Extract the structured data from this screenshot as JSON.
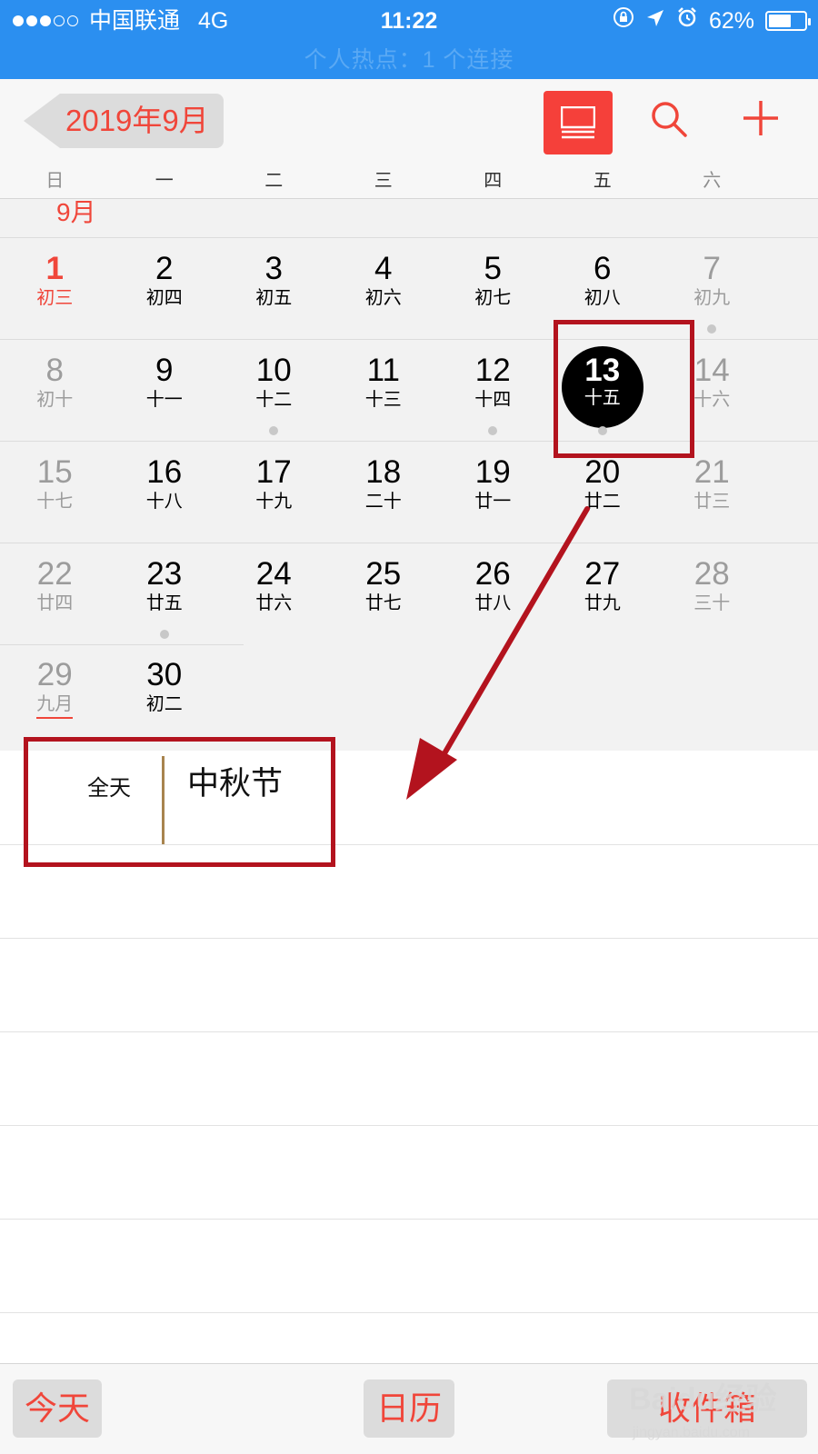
{
  "status_bar": {
    "carrier": "●●●○○ 中国联通",
    "carrier_name": "中国联通",
    "network": "4G",
    "time": "11:22",
    "battery_percent": "62%",
    "battery_level": 0.62,
    "hotspot": "个人热点：1 个连接"
  },
  "nav": {
    "back_label": "2019年9月",
    "list_icon": "list-view-icon",
    "search_icon": "search-icon",
    "add_icon": "plus-icon"
  },
  "weekdays": [
    "日",
    "一",
    "二",
    "三",
    "四",
    "五",
    "六"
  ],
  "month_label": "9月",
  "weeks": [
    [
      {
        "day": "1",
        "lunar": "初三",
        "today": true
      },
      {
        "day": "2",
        "lunar": "初四"
      },
      {
        "day": "3",
        "lunar": "初五"
      },
      {
        "day": "4",
        "lunar": "初六"
      },
      {
        "day": "5",
        "lunar": "初七"
      },
      {
        "day": "6",
        "lunar": "初八"
      },
      {
        "day": "7",
        "lunar": "初九",
        "dot": true
      }
    ],
    [
      {
        "day": "8",
        "lunar": "初十"
      },
      {
        "day": "9",
        "lunar": "十一"
      },
      {
        "day": "10",
        "lunar": "十二",
        "dot": true
      },
      {
        "day": "11",
        "lunar": "十三"
      },
      {
        "day": "12",
        "lunar": "十四",
        "dot": true
      },
      {
        "day": "13",
        "lunar": "十五",
        "selected": true,
        "dot": true
      },
      {
        "day": "14",
        "lunar": "十六"
      }
    ],
    [
      {
        "day": "15",
        "lunar": "十七"
      },
      {
        "day": "16",
        "lunar": "十八"
      },
      {
        "day": "17",
        "lunar": "十九"
      },
      {
        "day": "18",
        "lunar": "二十"
      },
      {
        "day": "19",
        "lunar": "廿一"
      },
      {
        "day": "20",
        "lunar": "廿二"
      },
      {
        "day": "21",
        "lunar": "廿三"
      }
    ],
    [
      {
        "day": "22",
        "lunar": "廿四"
      },
      {
        "day": "23",
        "lunar": "廿五",
        "dot": true
      },
      {
        "day": "24",
        "lunar": "廿六"
      },
      {
        "day": "25",
        "lunar": "廿七"
      },
      {
        "day": "26",
        "lunar": "廿八"
      },
      {
        "day": "27",
        "lunar": "廿九"
      },
      {
        "day": "28",
        "lunar": "三十"
      }
    ],
    [
      {
        "day": "29",
        "lunar": "九月",
        "underline": true
      },
      {
        "day": "30",
        "lunar": "初二"
      }
    ]
  ],
  "event": {
    "time_label": "全天",
    "title": "中秋节"
  },
  "tabs": {
    "today": "今天",
    "calendar": "日历",
    "inbox": "收件箱"
  },
  "watermark": "Baidu经验 jingyan.baidu.com",
  "colors": {
    "accent": "#f0463a",
    "status_bar": "#2b8ff0",
    "annotation": "#b3131e",
    "event_bar": "#a8844e"
  }
}
